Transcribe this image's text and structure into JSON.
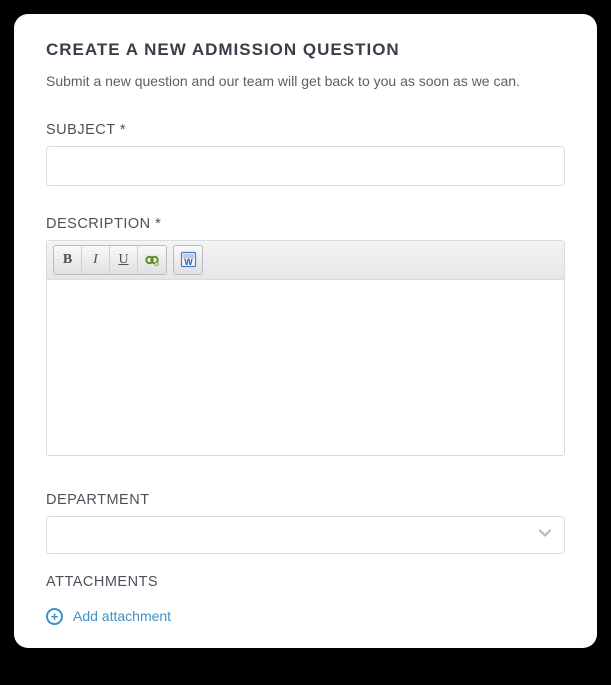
{
  "header": {
    "title": "CREATE A NEW ADMISSION QUESTION",
    "intro": "Submit a new question and our team will get back to you as soon as we can."
  },
  "form": {
    "subject": {
      "label": "SUBJECT *",
      "value": ""
    },
    "description": {
      "label": "DESCRIPTION *",
      "value": ""
    },
    "department": {
      "label": "DEPARTMENT",
      "selected": ""
    },
    "attachments": {
      "label": "ATTACHMENTS",
      "add_label": "Add attachment"
    }
  },
  "toolbar": {
    "icons": {
      "bold": "bold-icon",
      "italic": "italic-icon",
      "underline": "underline-icon",
      "link": "link-icon",
      "paste_word": "paste-word-icon"
    }
  }
}
